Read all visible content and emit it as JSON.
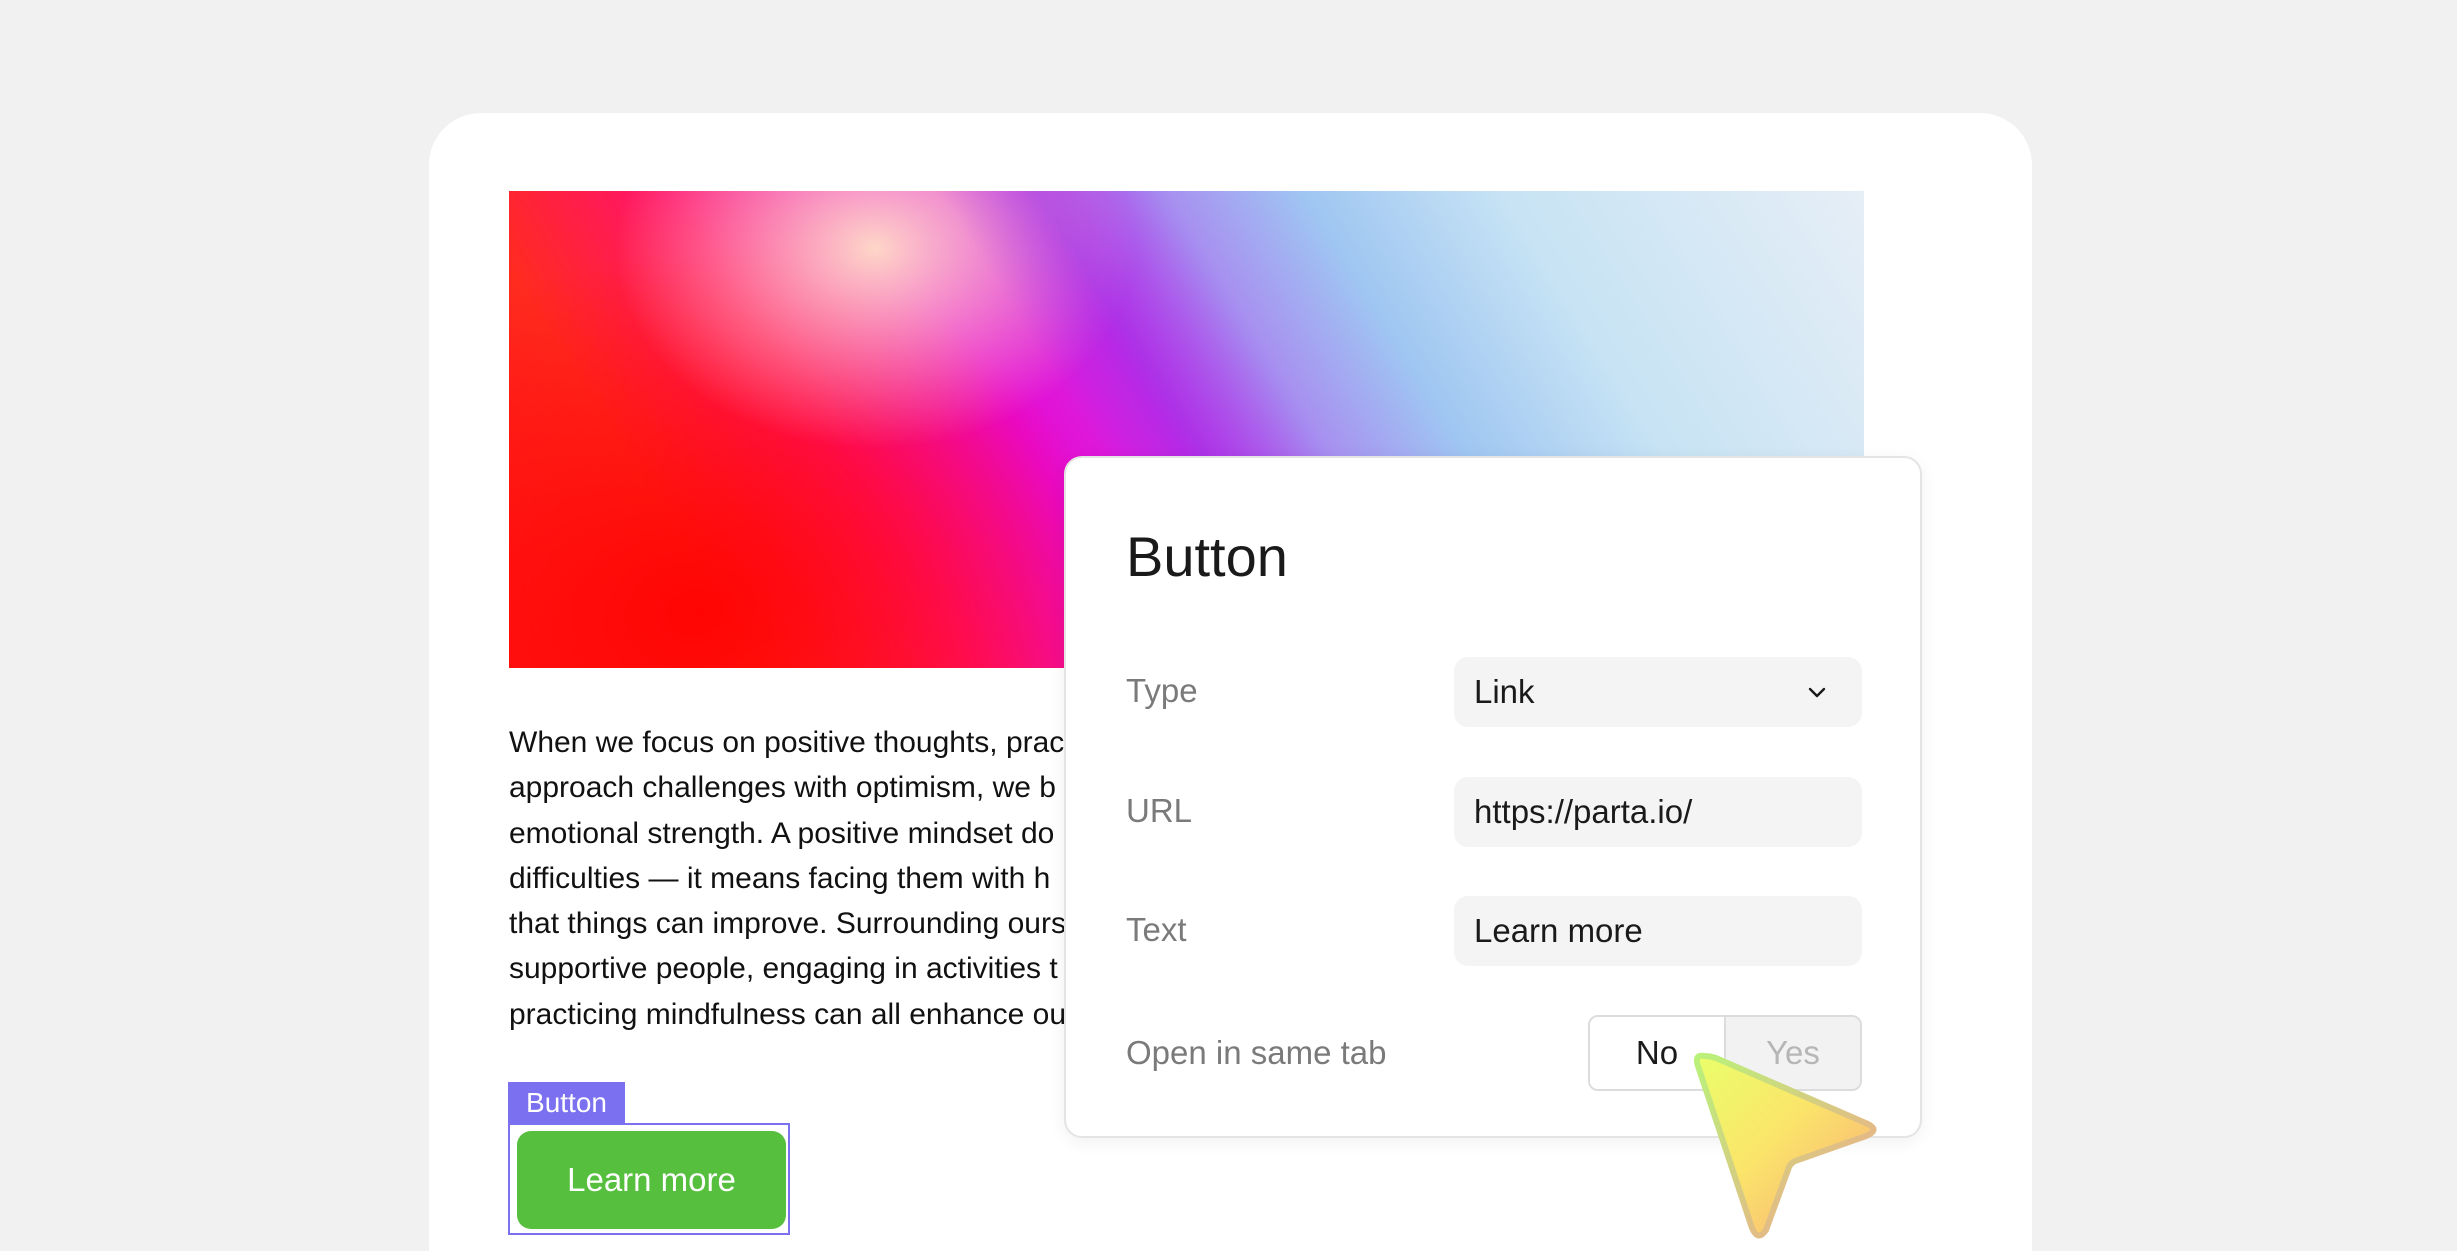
{
  "content": {
    "paragraph_lines": [
      "When we focus on positive thoughts, prac",
      "approach challenges with optimism, we b",
      "emotional strength. A positive mindset do",
      "difficulties — it means facing them with h",
      "that things can improve. Surrounding ours",
      "supportive people, engaging in activities t",
      "practicing mindfulness can all enhance ou"
    ]
  },
  "selection": {
    "tag_label": "Button",
    "button_label": "Learn more",
    "button_color": "#57bf3e",
    "accent_color": "#7a70f0"
  },
  "popover": {
    "title": "Button",
    "fields": {
      "type": {
        "label": "Type",
        "value": "Link",
        "icon": "chevron-down-icon"
      },
      "url": {
        "label": "URL",
        "value": "https://parta.io/"
      },
      "text": {
        "label": "Text",
        "value": "Learn more"
      },
      "open_same_tab": {
        "label": "Open in same tab",
        "options": [
          "No",
          "Yes"
        ],
        "selected": "No"
      }
    }
  },
  "cursor": {
    "icon": "pointer-cursor-icon"
  }
}
